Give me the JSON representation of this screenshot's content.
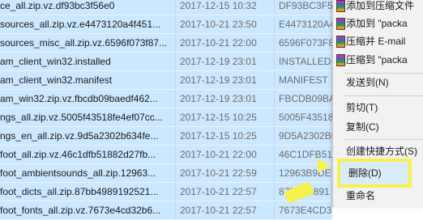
{
  "files": [
    {
      "name": "ce_all.zip.vz.df93bc3f56e0",
      "date": "2017-12-15 10:32",
      "hash": "DF93BC3F5C"
    },
    {
      "name": "sources_all.zip.vz.e4473120a4f451...",
      "date": "2017-10-21 23:50",
      "hash": "E4473120A4"
    },
    {
      "name": "sources_misc_all.zip.vz.6596f073f87...",
      "date": "2017-10-21 22:00",
      "hash": "6596F073F8"
    },
    {
      "name": "am_client_win32.installed",
      "date": "2017-12-19 23:01",
      "hash": "INSTALLED"
    },
    {
      "name": "am_client_win32.manifest",
      "date": "2017-12-19 23:01",
      "hash": "MANIFEST"
    },
    {
      "name": "am_win32.zip.vz.fbcdb09baedf462...",
      "date": "2017-12-19 23:01",
      "hash": "FBCDB09BA"
    },
    {
      "name": "ngs_all.zip.vz.5005f43518fe4ef07cc...",
      "date": "2017-12-15 10:25",
      "hash": "5005F43518"
    },
    {
      "name": "ngs_en_all.zip.vz.9d5a2302b634fe...",
      "date": "2017-12-15 10:25",
      "hash": "9D5A2302B6"
    },
    {
      "name": "foot_all.zip.vz.46c1dfb51882d27fb...",
      "date": "2017-10-21 22:00",
      "hash": "46C1DFB51"
    },
    {
      "name": "foot_ambientsounds_all.zip.12963...",
      "date": "2017-10-21 22:59",
      "hash": "12963B9DE"
    },
    {
      "name": "foot_dicts_all.zip.87bb4989192521...",
      "date": "2017-10-21 22:57",
      "hash": "87BB49891"
    },
    {
      "name": "foot_fonts_all.zip.vz.7673e4cd32b6...",
      "date": "2017-10-21 22:57",
      "hash": "7673E4CD3"
    }
  ],
  "context_menu": {
    "add_to_archive": "添加到压缩文件",
    "add_to_package": "添加到 \"packa",
    "compress_email": "压缩并 E-mail",
    "compress_to_package": "压缩到 \"packa",
    "send_to": "发送到(N)",
    "cut": "剪切(T)",
    "copy": "复制(C)",
    "create_shortcut": "创建快捷方式(S)",
    "delete": "删除(D)",
    "rename": "重命名"
  },
  "colors": {
    "selection": "#cce8ff",
    "highlight": "#f5f24c",
    "menu_bg": "#f2f2f2"
  }
}
